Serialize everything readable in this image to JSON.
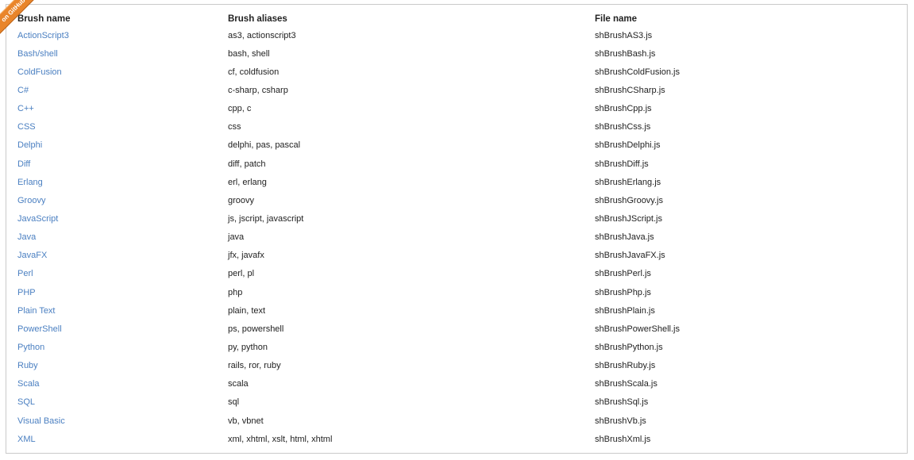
{
  "ribbon": {
    "label": "on GitHub"
  },
  "table": {
    "headers": [
      "Brush name",
      "Brush aliases",
      "File name"
    ],
    "rows": [
      {
        "name": "ActionScript3",
        "aliases": "as3, actionscript3",
        "file": "shBrushAS3.js"
      },
      {
        "name": "Bash/shell",
        "aliases": "bash, shell",
        "file": "shBrushBash.js"
      },
      {
        "name": "ColdFusion",
        "aliases": "cf, coldfusion",
        "file": "shBrushColdFusion.js"
      },
      {
        "name": "C#",
        "aliases": "c-sharp, csharp",
        "file": "shBrushCSharp.js"
      },
      {
        "name": "C++",
        "aliases": "cpp, c",
        "file": "shBrushCpp.js"
      },
      {
        "name": "CSS",
        "aliases": "css",
        "file": "shBrushCss.js"
      },
      {
        "name": "Delphi",
        "aliases": "delphi, pas, pascal",
        "file": "shBrushDelphi.js"
      },
      {
        "name": "Diff",
        "aliases": "diff, patch",
        "file": "shBrushDiff.js"
      },
      {
        "name": "Erlang",
        "aliases": "erl, erlang",
        "file": "shBrushErlang.js"
      },
      {
        "name": "Groovy",
        "aliases": "groovy",
        "file": "shBrushGroovy.js"
      },
      {
        "name": "JavaScript",
        "aliases": "js, jscript, javascript",
        "file": "shBrushJScript.js"
      },
      {
        "name": "Java",
        "aliases": "java",
        "file": "shBrushJava.js"
      },
      {
        "name": "JavaFX",
        "aliases": "jfx, javafx",
        "file": "shBrushJavaFX.js"
      },
      {
        "name": "Perl",
        "aliases": "perl, pl",
        "file": "shBrushPerl.js"
      },
      {
        "name": "PHP",
        "aliases": "php",
        "file": "shBrushPhp.js"
      },
      {
        "name": "Plain Text",
        "aliases": "plain, text",
        "file": "shBrushPlain.js"
      },
      {
        "name": "PowerShell",
        "aliases": "ps, powershell",
        "file": "shBrushPowerShell.js"
      },
      {
        "name": "Python",
        "aliases": "py, python",
        "file": "shBrushPython.js"
      },
      {
        "name": "Ruby",
        "aliases": "rails, ror, ruby",
        "file": "shBrushRuby.js"
      },
      {
        "name": "Scala",
        "aliases": "scala",
        "file": "shBrushScala.js"
      },
      {
        "name": "SQL",
        "aliases": "sql",
        "file": "shBrushSql.js"
      },
      {
        "name": "Visual Basic",
        "aliases": "vb, vbnet",
        "file": "shBrushVb.js"
      },
      {
        "name": "XML",
        "aliases": "xml, xhtml, xslt, html, xhtml",
        "file": "shBrushXml.js"
      }
    ]
  },
  "colors": {
    "link": "#4a7fc1",
    "text": "#222222",
    "ribbon": "#e9852a",
    "border": "#c9c9c9"
  }
}
